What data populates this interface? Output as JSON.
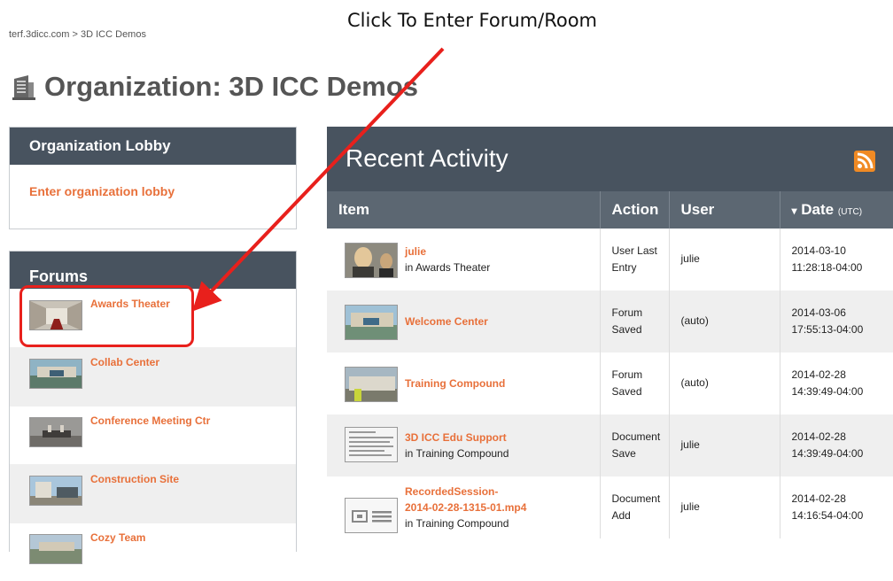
{
  "annotation": "Click To Enter Forum/Room",
  "breadcrumb": "terf.3dicc.com > 3D ICC Demos",
  "page_title": "Organization: 3D ICC Demos",
  "page_title_icon": "building-icon",
  "lobby": {
    "header": "Organization Lobby",
    "link": "Enter organization lobby"
  },
  "forums": {
    "header": "Forums",
    "items": [
      {
        "name": "Awards Theater",
        "icon": "forum-thumbnail"
      },
      {
        "name": "Collab Center",
        "icon": "forum-thumbnail"
      },
      {
        "name": "Conference Meeting Ctr",
        "icon": "forum-thumbnail"
      },
      {
        "name": "Construction Site",
        "icon": "forum-thumbnail"
      },
      {
        "name": "Cozy Team",
        "icon": "forum-thumbnail"
      }
    ]
  },
  "activity": {
    "title": "Recent Activity",
    "rss_icon": "rss-icon",
    "columns": {
      "item": "Item",
      "action": "Action",
      "user": "User",
      "date": "Date",
      "date_unit": "(UTC)",
      "sort_indicator": "▾"
    },
    "rows": [
      {
        "name": "julie",
        "location": "in Awards Theater",
        "action_line1": "User Last",
        "action_line2": "Entry",
        "user": "julie",
        "date": "2014-03-10",
        "time": "11:28:18-04:00"
      },
      {
        "name": "Welcome Center",
        "location": "",
        "action_line1": "Forum",
        "action_line2": "Saved",
        "user": "(auto)",
        "date": "2014-03-06",
        "time": "17:55:13-04:00"
      },
      {
        "name": "Training Compound",
        "location": "",
        "action_line1": "Forum",
        "action_line2": "Saved",
        "user": "(auto)",
        "date": "2014-02-28",
        "time": "14:39:49-04:00"
      },
      {
        "name": "3D ICC Edu Support",
        "location": "in Training Compound",
        "action_line1": "Document",
        "action_line2": "Save",
        "user": "julie",
        "date": "2014-02-28",
        "time": "14:39:49-04:00"
      },
      {
        "name": "RecordedSession-",
        "name2": "2014-02-28-1315-01.mp4",
        "location": "in Training Compound",
        "action_line1": "Document",
        "action_line2": "Add",
        "user": "julie",
        "date": "2014-02-28",
        "time": "14:16:54-04:00"
      }
    ]
  },
  "colors": {
    "accent": "#e8703a",
    "header": "#48535f",
    "annotation_red": "#e8201c"
  }
}
